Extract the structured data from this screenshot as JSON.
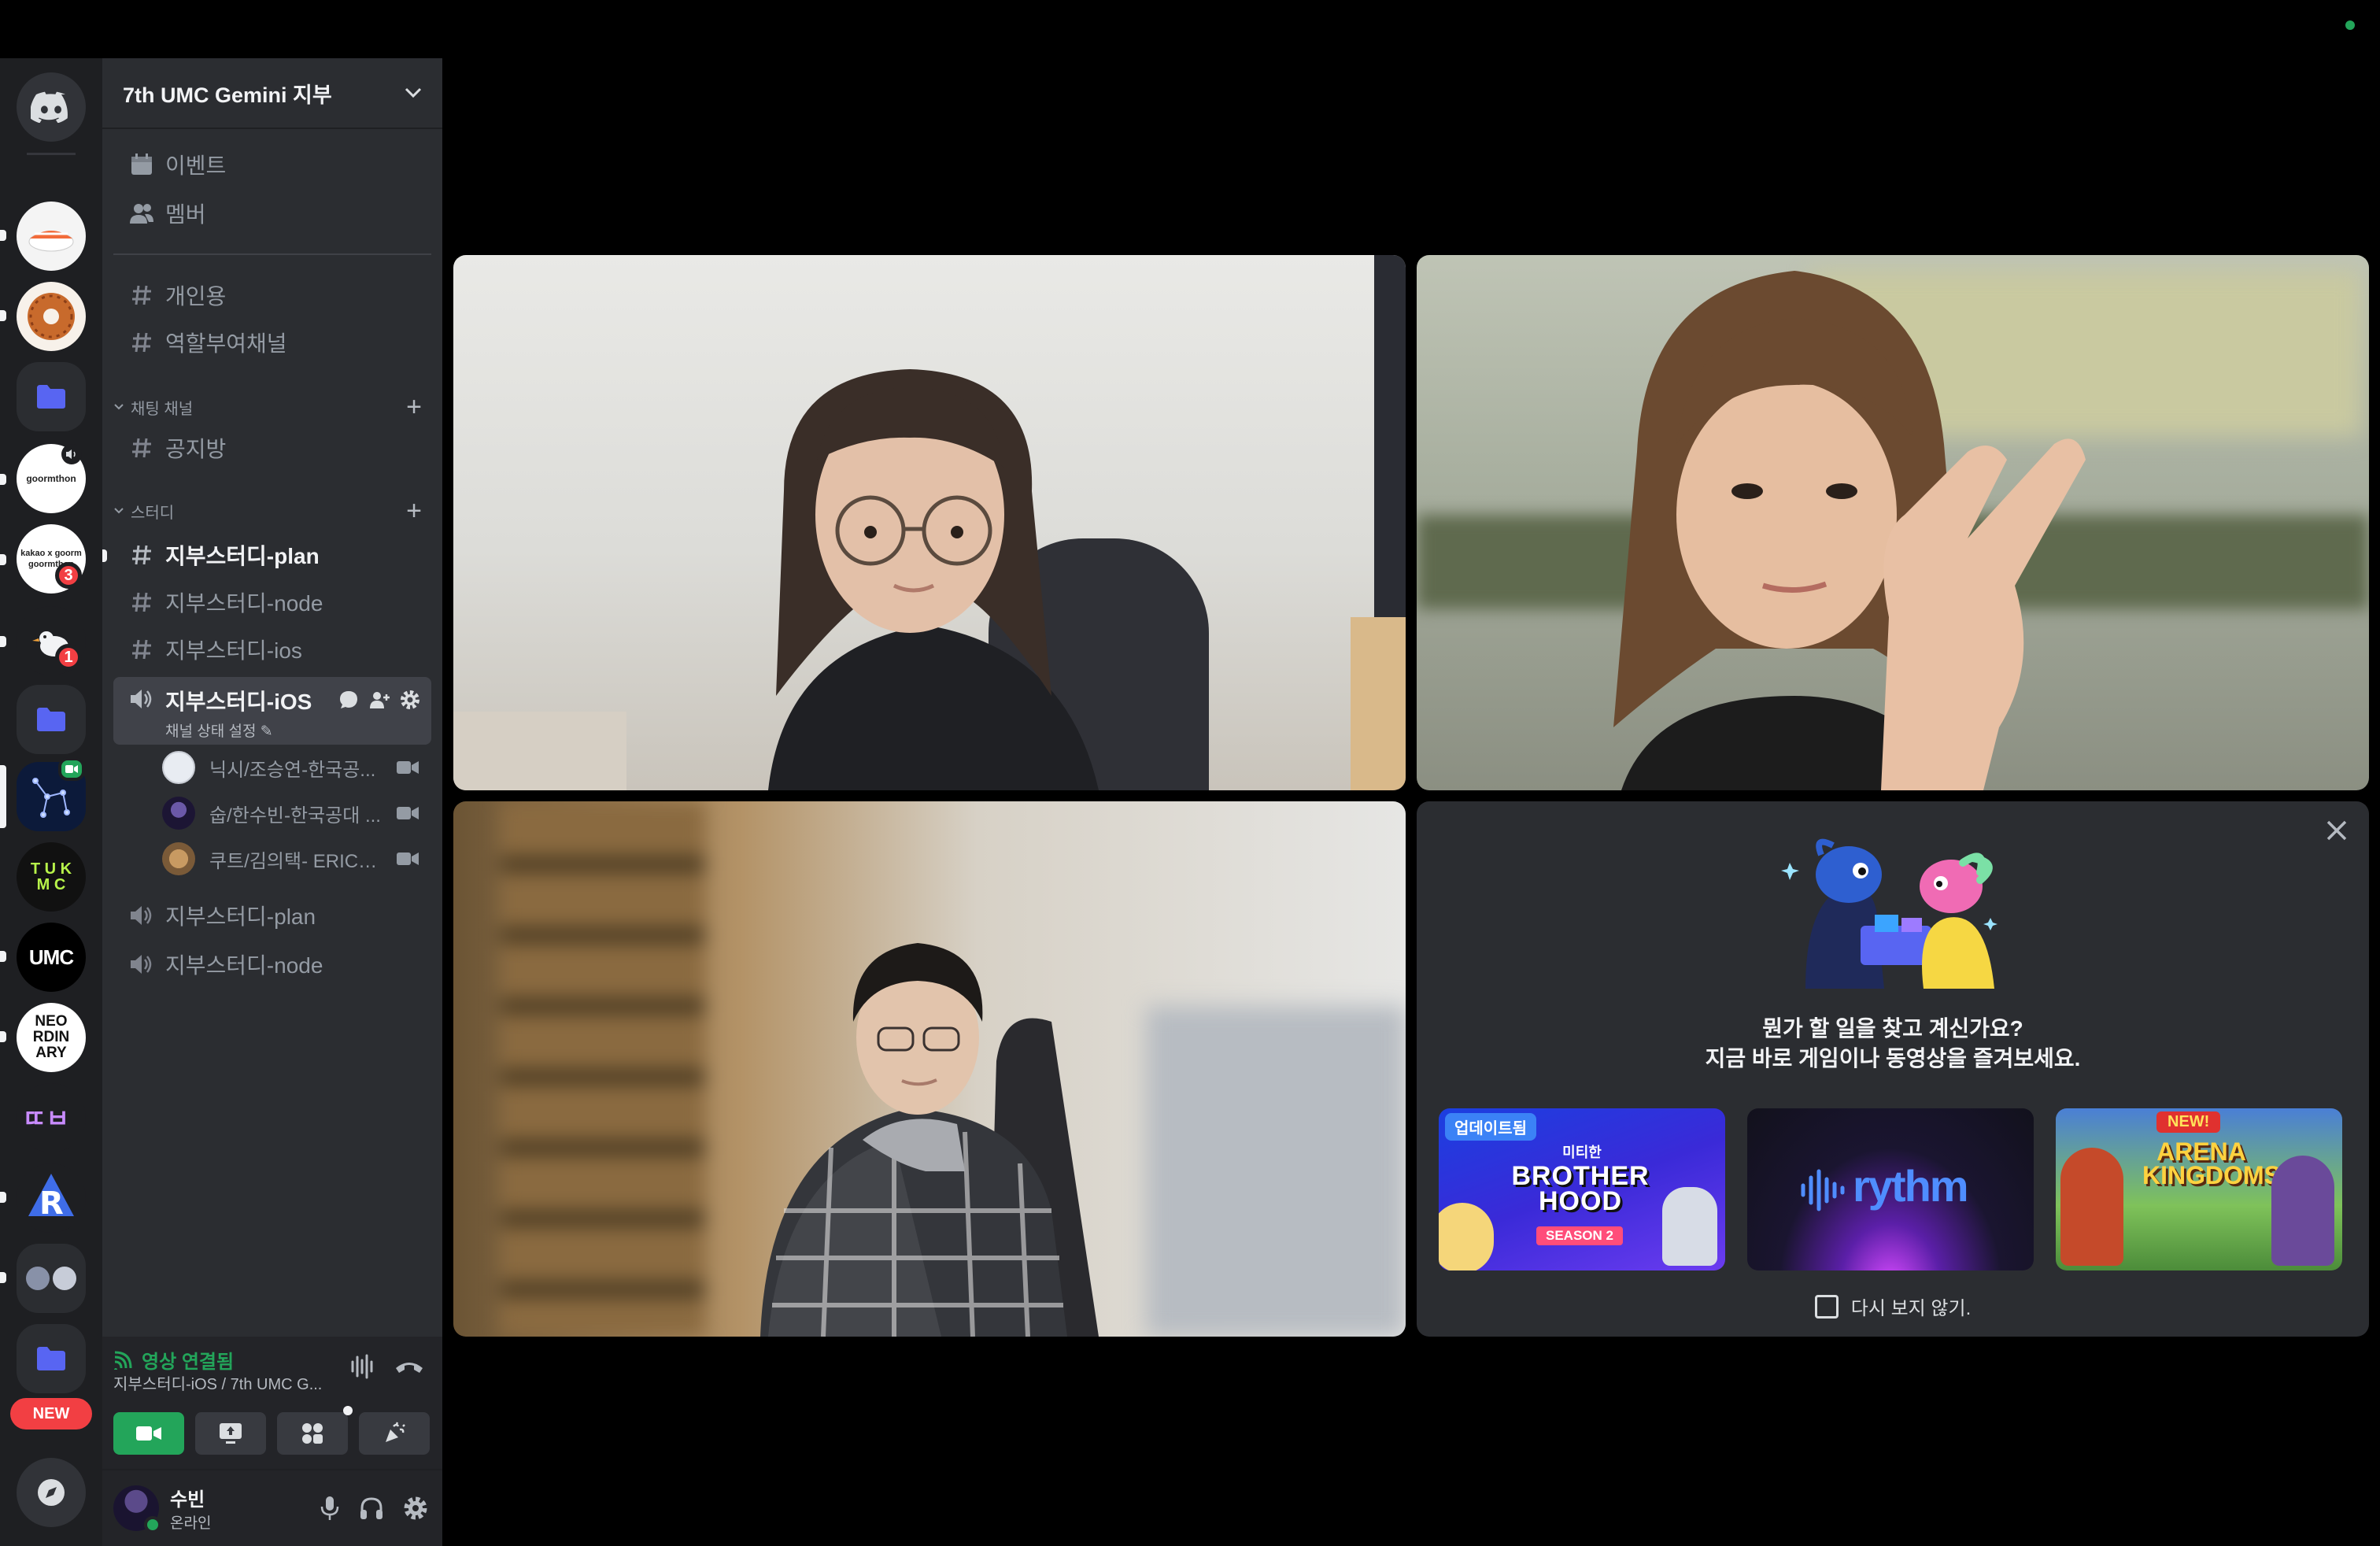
{
  "guild": {
    "name": "7th UMC Gemini 지부"
  },
  "nav": {
    "events": "이벤트",
    "members": "멤버"
  },
  "channels": {
    "top": [
      "개인용",
      "역할부여채널"
    ],
    "categories": [
      {
        "name": "채팅 채널",
        "channels": [
          "공지방"
        ]
      },
      {
        "name": "스터디",
        "channels": [
          "지부스터디-plan",
          "지부스터디-node",
          "지부스터디-ios"
        ]
      }
    ],
    "active_voice": {
      "name": "지부스터디-iOS",
      "status": "채널 상태 설정"
    },
    "voice_users": [
      "닉시/조승연-한국공...",
      "숩/한수빈-한국공대 ...",
      "쿠트/김의택- ERICA ..."
    ],
    "other_voice": [
      "지부스터디-plan",
      "지부스터디-node"
    ]
  },
  "servers": {
    "badges": [
      "3",
      "1"
    ],
    "new_label": "NEW"
  },
  "voice_panel": {
    "status": "영상 연결됨",
    "sub": "지부스터디-iOS / 7th UMC G..."
  },
  "user": {
    "name": "수빈",
    "status": "온라인"
  },
  "promo": {
    "line1": "뭔가 할 일을 찾고 계신가요?",
    "line2": "지금 바로 게임이나 동영상을 즐겨보세요.",
    "cards": [
      {
        "badge": "업데이트됨",
        "title": "BROTHER HOOD",
        "subtitle": "SEASON 2",
        "brand": "미티한"
      },
      {
        "title": "rythm"
      },
      {
        "badge": "NEW!",
        "title": "ARENA KINGDOMS"
      }
    ],
    "dont_show": "다시 보지 않기."
  },
  "colors": {
    "online": "#23a55a",
    "blurple": "#5865f2",
    "mention": "#f23f43"
  }
}
